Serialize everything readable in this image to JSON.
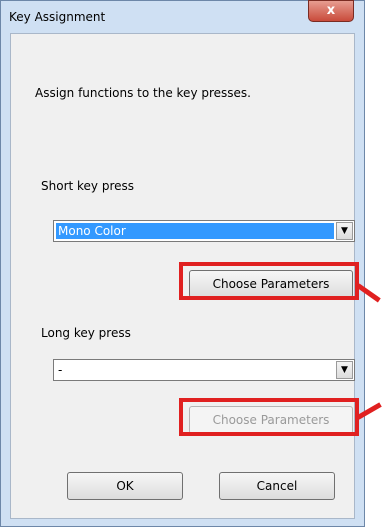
{
  "window": {
    "title": "Key Assignment",
    "close_label": "x"
  },
  "intro": "Assign functions to the key presses.",
  "short_press": {
    "label": "Short key press",
    "selected": "Mono Color",
    "choose_label": "Choose Parameters"
  },
  "long_press": {
    "label": "Long key press",
    "selected": "-",
    "choose_label": "Choose Parameters"
  },
  "buttons": {
    "ok": "OK",
    "cancel": "Cancel"
  },
  "colors": {
    "highlight": "#e02020",
    "selection": "#3399ff"
  }
}
